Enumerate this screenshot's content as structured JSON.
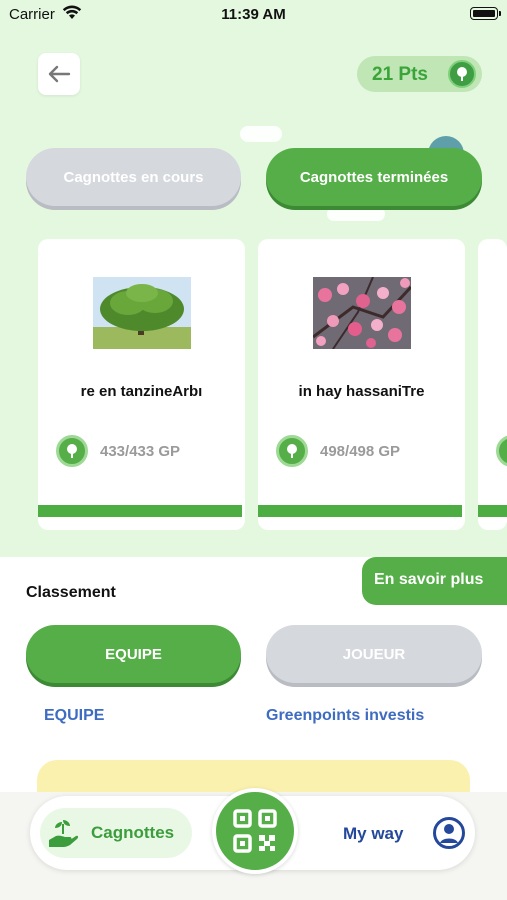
{
  "status_bar": {
    "carrier": "Carrier",
    "time": "11:39 AM"
  },
  "header": {
    "points": "21 Pts"
  },
  "tabs": {
    "ongoing": "Cagnottes en cours",
    "finished": "Cagnottes terminées",
    "active": "finished"
  },
  "cards": [
    {
      "title": "re en tanzineArbı",
      "amount": "433/433 GP",
      "progress": 1.0,
      "image": "tree-photo"
    },
    {
      "title": "in hay hassaniTre",
      "amount": "498/498 GP",
      "progress": 1.0,
      "image": "pink-blossom-photo"
    }
  ],
  "learn_more": "En savoir plus",
  "ranking": {
    "title": "Classement",
    "toggle_team": "EQUIPE",
    "toggle_player": "JOUEUR",
    "active": "team",
    "col_team": "EQUIPE",
    "col_points": "Greenpoints investis"
  },
  "bottom_nav": {
    "cagnottes": "Cagnottes",
    "my_way": "My way"
  },
  "colors": {
    "accent_green": "#55ae48",
    "light_green_bg": "#e4f8e0",
    "blue_text": "#3e6cc1",
    "navy": "#24489a"
  }
}
